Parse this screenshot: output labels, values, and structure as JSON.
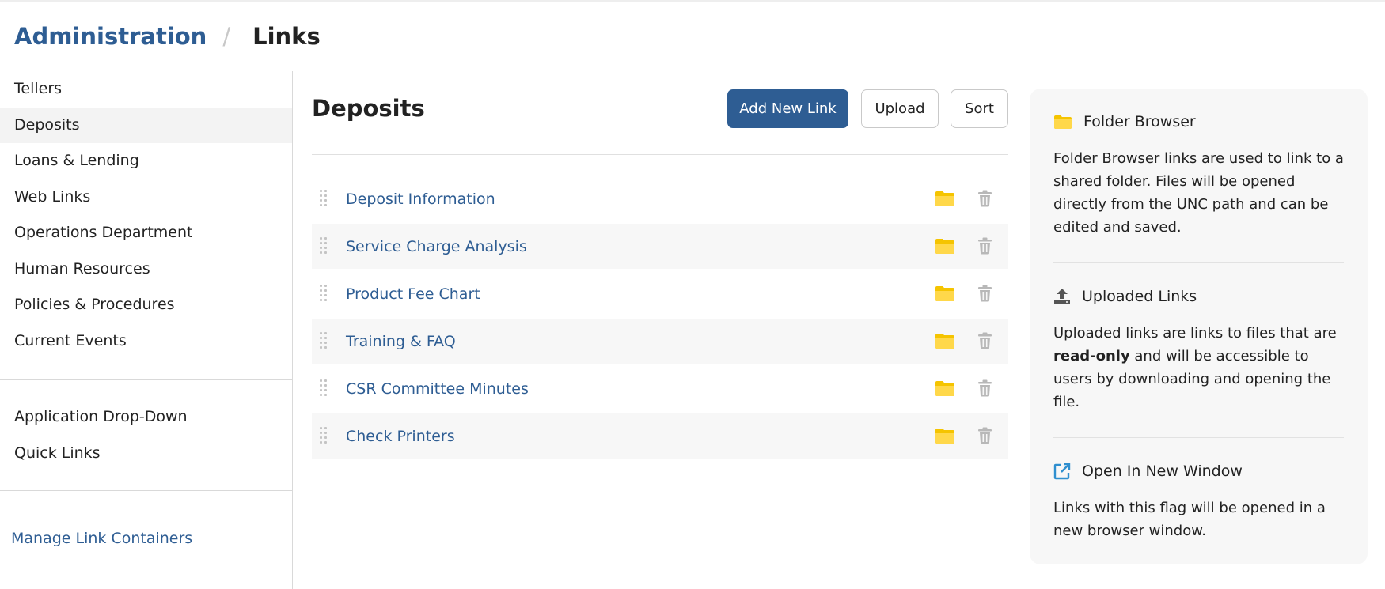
{
  "breadcrumb": {
    "parent": "Administration",
    "separator": "/",
    "current": "Links"
  },
  "sidebar": {
    "groups": [
      [
        "Tellers",
        "Deposits",
        "Loans & Lending",
        "Web Links",
        "Operations Department",
        "Human Resources",
        "Policies & Procedures",
        "Current Events"
      ],
      [
        "Application Drop-Down",
        "Quick Links"
      ]
    ],
    "active": "Deposits",
    "manage_link": "Manage Link Containers"
  },
  "main": {
    "title": "Deposits",
    "buttons": {
      "add": "Add New Link",
      "upload": "Upload",
      "sort": "Sort"
    },
    "links": [
      "Deposit Information",
      "Service Charge Analysis",
      "Product Fee Chart",
      "Training & FAQ",
      "CSR Committee Minutes",
      "Check Printers"
    ]
  },
  "info": {
    "folder_browser": {
      "icon": "folder-icon",
      "title": "Folder Browser",
      "text": "Folder Browser links are used to link to a shared folder. Files will be opened directly from the UNC path and can be edited and saved."
    },
    "uploaded_links": {
      "icon": "upload-icon",
      "title": "Uploaded Links",
      "text_before": "Uploaded links are links to files that are ",
      "text_bold": "read-only",
      "text_after": " and will be accessible to users by downloading and opening the file."
    },
    "new_window": {
      "icon": "external-link-icon",
      "title": "Open In New Window",
      "text": "Links with this flag will be opened in a new browser window."
    }
  },
  "colors": {
    "brand": "#2e5d93",
    "folder": "#f5c400",
    "trash": "#b8b8b8",
    "external_link": "#2f8fcf"
  }
}
